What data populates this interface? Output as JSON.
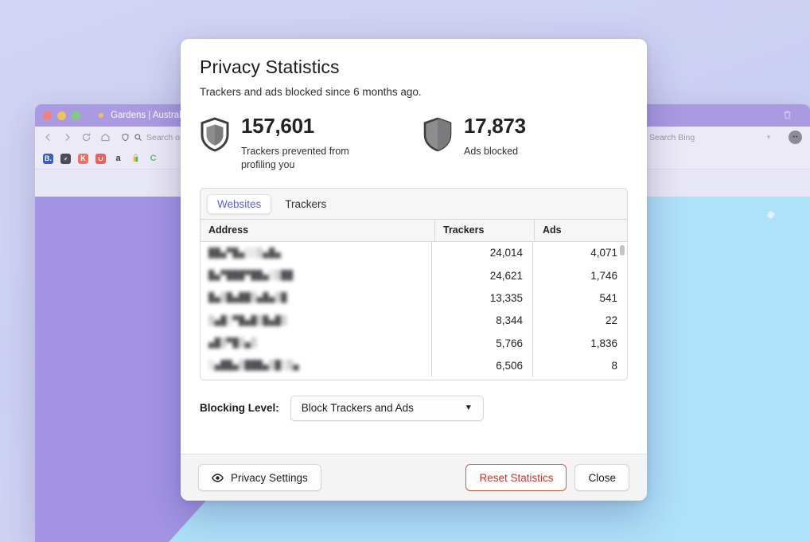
{
  "desktop": {
    "background_color": "#ccd0f2"
  },
  "browser": {
    "tab_title": "Gardens | Australian Gar",
    "url_placeholder": "Search or",
    "search_placeholder": "Search Bing",
    "bookmarks": [
      {
        "name": "booking-bookmark",
        "label": "B.",
        "color": "#3a5fb8"
      },
      {
        "name": "compass-bookmark",
        "label": "",
        "color": "#4a4a52"
      },
      {
        "name": "kijiji-bookmark",
        "label": "K",
        "color": "#e6746a"
      },
      {
        "name": "etsy-bookmark",
        "label": "u",
        "color": "#e8625c"
      },
      {
        "name": "amazon-bookmark",
        "label": "a",
        "color": "#00000000"
      },
      {
        "name": "shopping-bag-bookmark",
        "label": "",
        "color": "#e6b94a"
      },
      {
        "name": "c-bookmark",
        "label": "C",
        "color": "#00000000"
      }
    ],
    "icons": {
      "back": "back-arrow-icon",
      "forward": "forward-arrow-icon",
      "reload": "reload-icon",
      "home": "home-icon",
      "shield": "shield-icon",
      "search": "search-icon",
      "trash": "trash-icon",
      "gear": "gear-icon",
      "avatar": "profile-avatar"
    }
  },
  "dialog": {
    "title": "Privacy Statistics",
    "subtitle": "Trackers and ads blocked since 6 months ago.",
    "stats": [
      {
        "icon": "shield-outline-icon",
        "value": "157,601",
        "label": "Trackers prevented from profiling you"
      },
      {
        "icon": "shield-filled-icon",
        "value": "17,873",
        "label": "Ads blocked"
      }
    ],
    "tabs": [
      {
        "label": "Websites",
        "active": true
      },
      {
        "label": "Trackers",
        "active": false
      }
    ],
    "table": {
      "columns": [
        "Address",
        "Trackers",
        "Ads"
      ],
      "rows": [
        {
          "address": "██▄▀█▄░░▒▄█▄",
          "trackers": "24,014",
          "ads": "4,071"
        },
        {
          "address": "█▄▀███▀██▄░▒██",
          "trackers": "24,621",
          "ads": "1,746"
        },
        {
          "address": "█▄▒█▄██▒▄█▄▒█",
          "trackers": "13,335",
          "ads": "541"
        },
        {
          "address": "▒▄█░▀█▄█▒█▄█▒",
          "trackers": "8,344",
          "ads": "22"
        },
        {
          "address": "▄█▒▀█▒▄▒",
          "trackers": "5,766",
          "ads": "1,836"
        },
        {
          "address": "░▄██▄▒███▄▒█░▒▄",
          "trackers": "6,506",
          "ads": "8"
        }
      ],
      "scrollbar": "vertical-scrollbar"
    },
    "blocking": {
      "label": "Blocking Level:",
      "selected_option": "Block Trackers and Ads",
      "caret": "▼"
    },
    "footer": {
      "privacy_settings_label": "Privacy Settings",
      "privacy_settings_icon": "eye-icon",
      "reset_label": "Reset Statistics",
      "close_label": "Close"
    },
    "colors": {
      "accent": "#5b63d3",
      "danger": "#c0392b",
      "footer_bg": "#f4f4f5"
    }
  }
}
